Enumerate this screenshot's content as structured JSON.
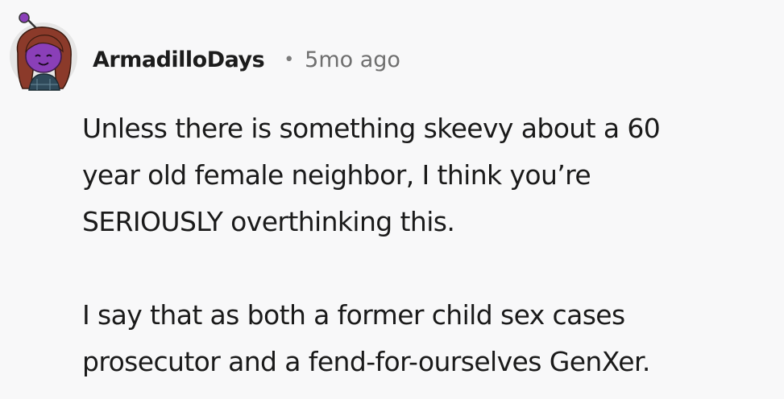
{
  "comment": {
    "author": "ArmadilloDays",
    "separator": "•",
    "timestamp": "5mo ago",
    "avatar_icon": "snoo-avatar-icon",
    "paragraphs": [
      {
        "lines": [
          "Unless there is something skeevy about a 60",
          "year old female neighbor, I think you’re",
          "SERIOUSLY overthinking this."
        ]
      },
      {
        "lines": [
          "I say that as both a former child sex cases",
          "prosecutor and a fend-for-ourselves GenXer."
        ]
      }
    ]
  },
  "colors": {
    "background": "#f8f8f9",
    "author": "#1c1c1c",
    "meta": "#6f6f6f",
    "avatar_skin": "#8a3fb8",
    "avatar_hair": "#8b3a2a",
    "avatar_shirt": "#2f4a5a"
  }
}
